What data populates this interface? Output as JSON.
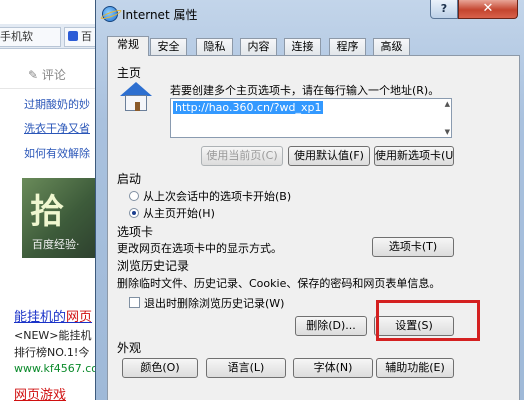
{
  "background": {
    "tab1_label": "手机软",
    "tab2_label": "百",
    "comment_label": "✎ 评论",
    "links": [
      "过期酸奶的妙",
      "洗衣干净又省",
      "如何有效解除"
    ],
    "image_logo": "拾",
    "image_caption": "百度经验·",
    "result_title_hl": "能挂机的",
    "result_title_rest": "网页",
    "result_lines": [
      "<NEW>能挂机",
      "排行榜NO.1!今"
    ],
    "result_url": "www.kf4567.con",
    "bottom_link": "网页游戏"
  },
  "dialog": {
    "title": "Internet 属性",
    "help_label": "?",
    "close_label": "✕",
    "tabs": [
      "常规",
      "安全",
      "隐私",
      "内容",
      "连接",
      "程序",
      "高级"
    ],
    "homepage": {
      "label": "主页",
      "hint": "若要创建多个主页选项卡，请在每行输入一个地址(R)。",
      "url": "http://hao.360.cn/?wd_xp1",
      "btn_current": "使用当前页(C)",
      "btn_default": "使用默认值(F)",
      "btn_newtab": "使用新选项卡(U)"
    },
    "startup": {
      "label": "启动",
      "option1": "从上次会话中的选项卡开始(B)",
      "option2": "从主页开始(H)",
      "selected": 2
    },
    "tabs_section": {
      "label": "选项卡",
      "desc": "更改网页在选项卡中的显示方式。",
      "btn": "选项卡(T)"
    },
    "history": {
      "label": "浏览历史记录",
      "desc": "删除临时文件、历史记录、Cookie、保存的密码和网页表单信息。",
      "checkbox_label": "退出时删除浏览历史记录(W)",
      "btn_delete": "删除(D)...",
      "btn_settings": "设置(S)"
    },
    "appearance": {
      "label": "外观",
      "btn_colors": "颜色(O)",
      "btn_languages": "语言(L)",
      "btn_fonts": "字体(N)",
      "btn_accessibility": "辅助功能(E)"
    }
  }
}
